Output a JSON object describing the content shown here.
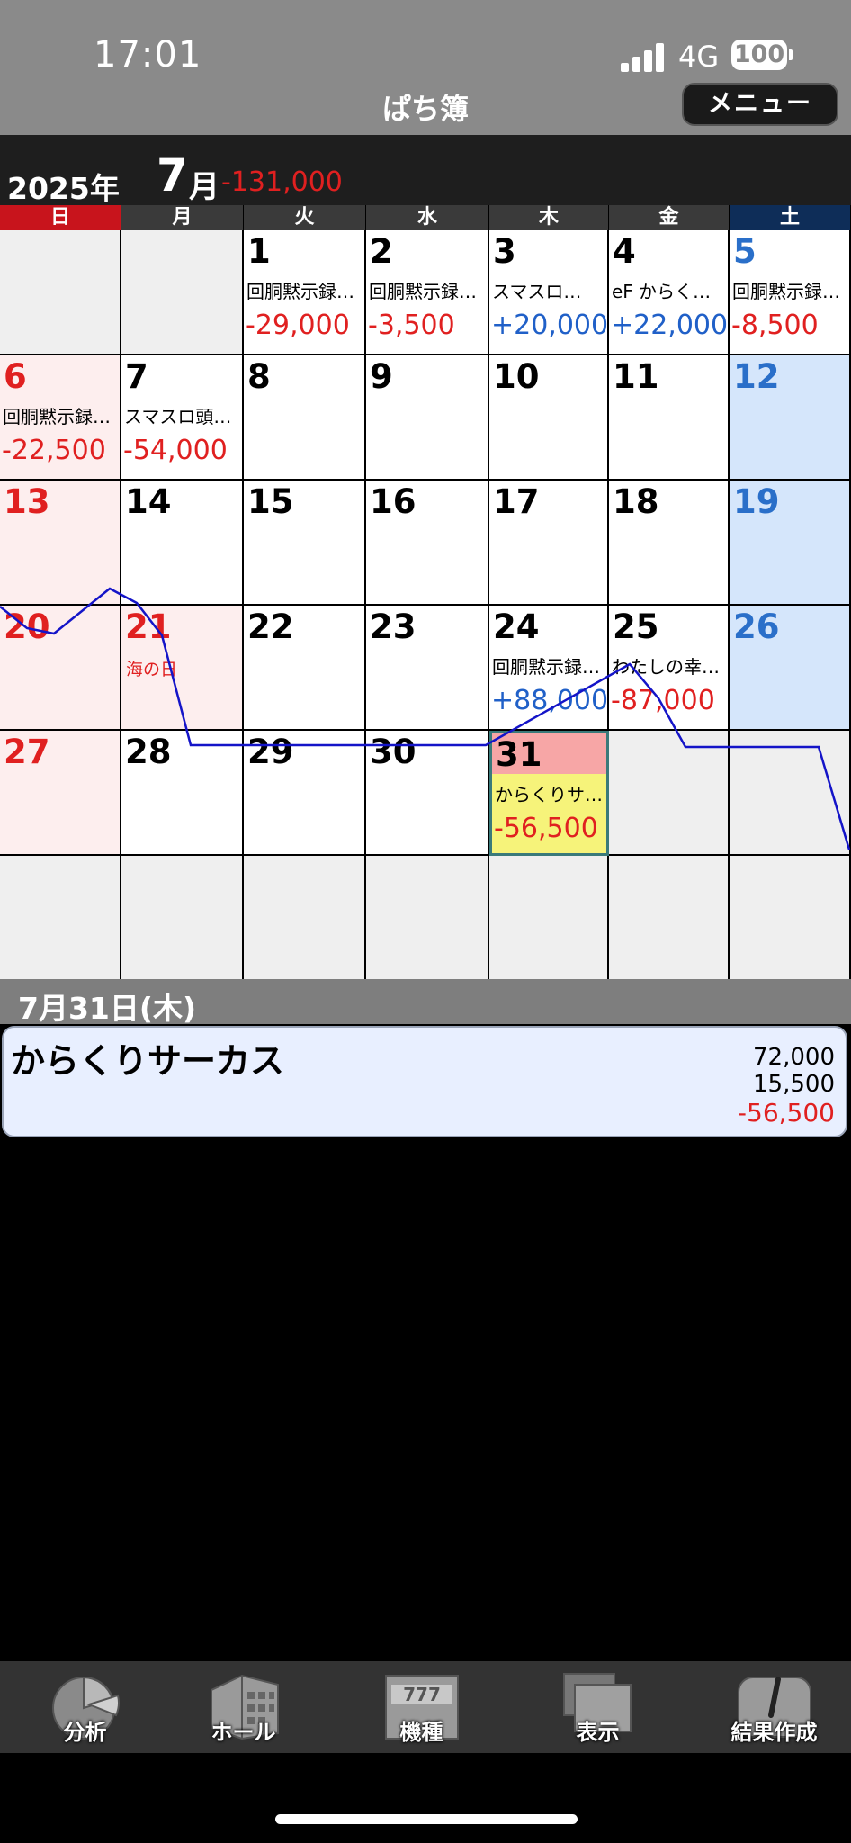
{
  "status_bar": {
    "time": "17:01",
    "network": "4G",
    "battery": "100"
  },
  "app": {
    "title": "ぱち簿",
    "menu_label": "メニュー"
  },
  "month_header": {
    "year": "2025年",
    "month_num": "7",
    "month_kanji": "月",
    "total": "-131,000"
  },
  "weekdays": [
    {
      "label": "日",
      "color": "#c8141c"
    },
    {
      "label": "月",
      "color": "#3a3a3a"
    },
    {
      "label": "火",
      "color": "#3a3a3a"
    },
    {
      "label": "水",
      "color": "#3a3a3a"
    },
    {
      "label": "木",
      "color": "#3a3a3a"
    },
    {
      "label": "金",
      "color": "#3a3a3a"
    },
    {
      "label": "土",
      "color": "#0e2d58"
    }
  ],
  "calendar": [
    [
      {
        "day": "",
        "type": "grey"
      },
      {
        "day": "",
        "type": "grey"
      },
      {
        "day": "1",
        "type": "white",
        "memo": "回胴黙示録…",
        "amount": "-29,000",
        "sign": "neg"
      },
      {
        "day": "2",
        "type": "white",
        "memo": "回胴黙示録…",
        "amount": "-3,500",
        "sign": "neg"
      },
      {
        "day": "3",
        "type": "white",
        "memo": "スマスロ…",
        "amount": "+20,000",
        "sign": "pos"
      },
      {
        "day": "4",
        "type": "white",
        "memo": "eF からく…",
        "amount": "+22,000",
        "sign": "pos"
      },
      {
        "day": "5",
        "type": "white",
        "num_color": "blue",
        "memo": "回胴黙示録…",
        "amount": "-8,500",
        "sign": "neg"
      }
    ],
    [
      {
        "day": "6",
        "type": "pink",
        "num_color": "red",
        "memo": "回胴黙示録…",
        "amount": "-22,500",
        "sign": "neg"
      },
      {
        "day": "7",
        "type": "white",
        "memo": "スマスロ頭…",
        "amount": "-54,000",
        "sign": "neg"
      },
      {
        "day": "8",
        "type": "white"
      },
      {
        "day": "9",
        "type": "white"
      },
      {
        "day": "10",
        "type": "white"
      },
      {
        "day": "11",
        "type": "white"
      },
      {
        "day": "12",
        "type": "blue",
        "num_color": "blue"
      }
    ],
    [
      {
        "day": "13",
        "type": "pink",
        "num_color": "red"
      },
      {
        "day": "14",
        "type": "white"
      },
      {
        "day": "15",
        "type": "white"
      },
      {
        "day": "16",
        "type": "white"
      },
      {
        "day": "17",
        "type": "white"
      },
      {
        "day": "18",
        "type": "white"
      },
      {
        "day": "19",
        "type": "blue",
        "num_color": "blue"
      }
    ],
    [
      {
        "day": "20",
        "type": "pink",
        "num_color": "red"
      },
      {
        "day": "21",
        "type": "pink",
        "num_color": "red",
        "holiday": "海の日"
      },
      {
        "day": "22",
        "type": "white"
      },
      {
        "day": "23",
        "type": "white"
      },
      {
        "day": "24",
        "type": "white",
        "memo": "回胴黙示録…",
        "amount": "+88,000",
        "sign": "pos"
      },
      {
        "day": "25",
        "type": "white",
        "memo": "わたしの幸…",
        "amount": "-87,000",
        "sign": "neg"
      },
      {
        "day": "26",
        "type": "blue",
        "num_color": "blue"
      }
    ],
    [
      {
        "day": "27",
        "type": "pink",
        "num_color": "red"
      },
      {
        "day": "28",
        "type": "white"
      },
      {
        "day": "29",
        "type": "white"
      },
      {
        "day": "30",
        "type": "white"
      },
      {
        "day": "31",
        "type": "sel",
        "memo": "からくりサ…",
        "amount": "-56,500",
        "sign": "neg"
      },
      {
        "day": "",
        "type": "grey"
      },
      {
        "day": "",
        "type": "grey"
      }
    ],
    [
      {
        "day": "",
        "type": "grey"
      },
      {
        "day": "",
        "type": "grey"
      },
      {
        "day": "",
        "type": "grey"
      },
      {
        "day": "",
        "type": "grey"
      },
      {
        "day": "",
        "type": "grey"
      },
      {
        "day": "",
        "type": "grey"
      },
      {
        "day": "",
        "type": "grey"
      }
    ]
  ],
  "selected_date": "7月31日(木)",
  "entry": {
    "name": "からくりサーカス",
    "investment": "72,000",
    "recovery": "15,500",
    "balance": "-56,500"
  },
  "tabs": [
    {
      "label": "分析",
      "icon": "pie-chart-icon"
    },
    {
      "label": "ホール",
      "icon": "building-icon"
    },
    {
      "label": "機種",
      "icon": "slot-machine-icon"
    },
    {
      "label": "表示",
      "icon": "display-icon"
    },
    {
      "label": "結果作成",
      "icon": "edit-icon"
    }
  ]
}
